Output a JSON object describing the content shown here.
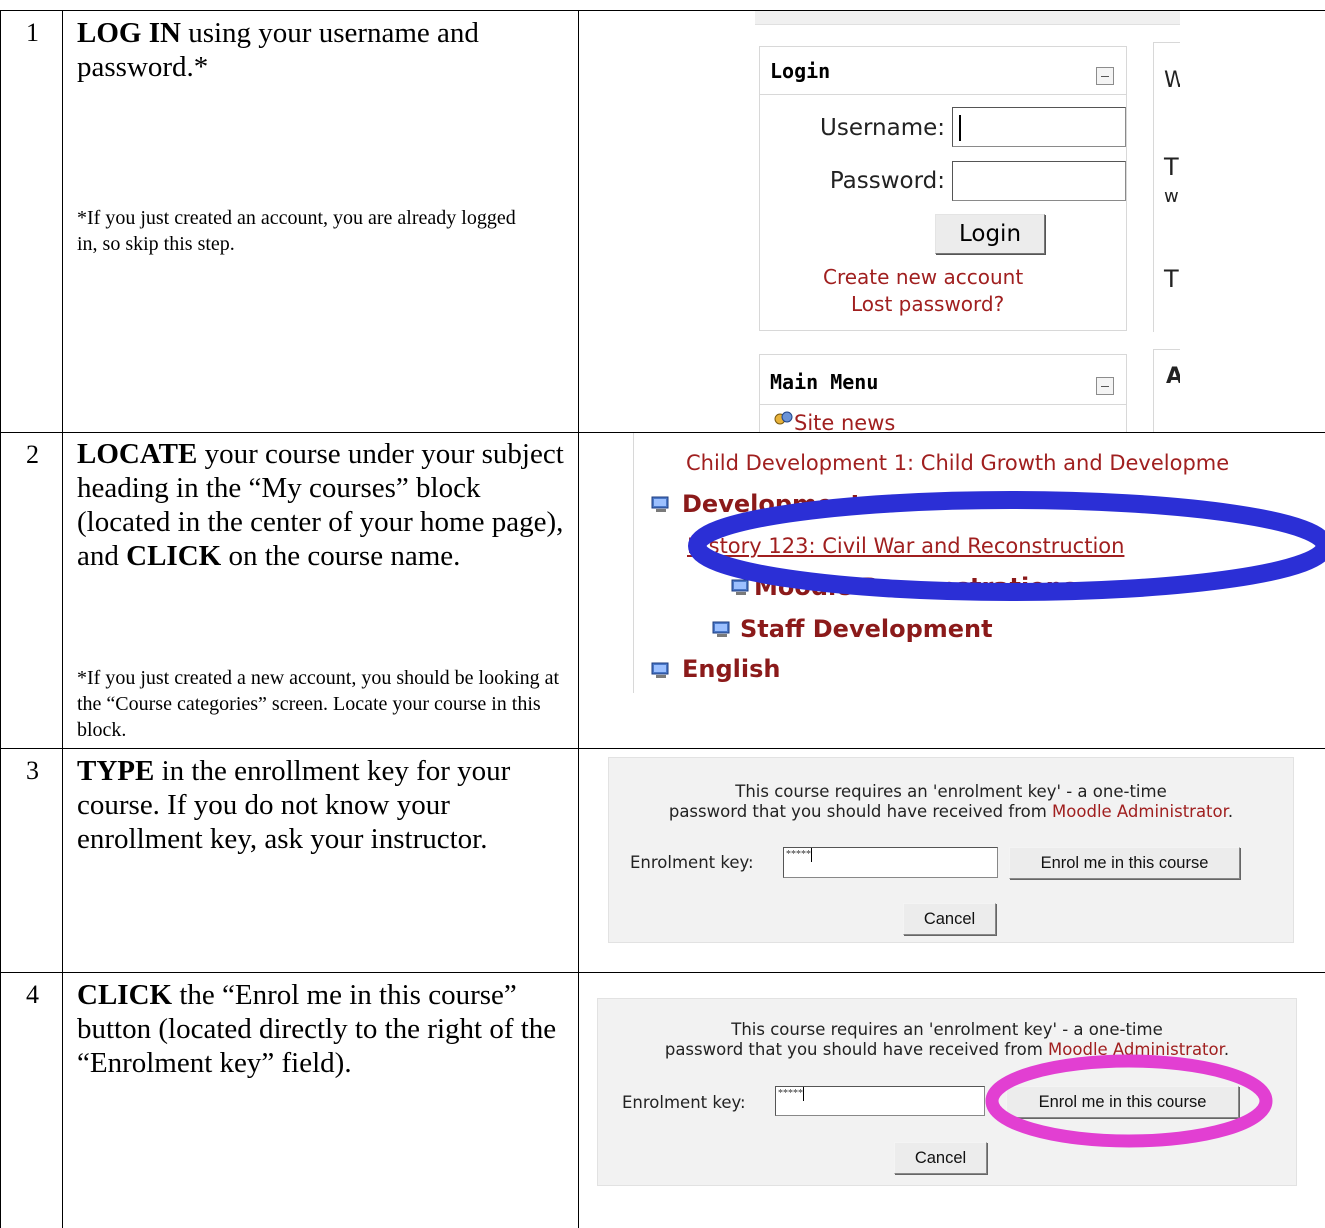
{
  "steps": [
    {
      "number": "1",
      "action": "LOG IN",
      "text": " using your username and password.*",
      "note": "*If you just created an account, you are already logged in, so skip this step."
    },
    {
      "number": "2",
      "action1": "LOCATE",
      "text1": " your course under your subject heading in the “My courses” block (located in the center of your home page), and ",
      "action2": "CLICK",
      "text2": " on the course name.",
      "note": "*If you just created a new account, you should be looking at the “Course categories” screen. Locate your course in this block."
    },
    {
      "number": "3",
      "action": "TYPE",
      "text": " in the enrollment key for your course. If you do not know your enrollment key, ask your instructor."
    },
    {
      "number": "4",
      "action": "CLICK",
      "text": " the “Enrol me in this course” button (located directly to the right of the “Enrolment key” field)."
    }
  ],
  "login_block": {
    "title": "Login",
    "username_label": "Username:",
    "password_label": "Password:",
    "login_button": "Login",
    "create_account": "Create new account",
    "lost_password": "Lost password?"
  },
  "side_glyphs": [
    "W",
    "T",
    "w",
    "T",
    "A"
  ],
  "main_menu": {
    "title": "Main Menu",
    "site_news": "Site news"
  },
  "categories": {
    "child_dev": "Child Development 1: Child Growth and Developme",
    "development": "Development",
    "history": "History 123: Civil War and Reconstruction",
    "moodle_demos": "Moodle Demonstrations",
    "staff_dev": "Staff Development",
    "english": "English",
    "highlight_color": "#2b2fd6"
  },
  "enrol": {
    "message_line1": "This course requires an 'enrolment key' - a one-time",
    "message_line2_prefix": "password that you should have received from ",
    "admin": "Moodle Administrator",
    "message_line2_suffix": ".",
    "key_label": "Enrolment key:",
    "key_value": "*****",
    "enrol_button": "Enrol me in this course",
    "cancel_button": "Cancel",
    "highlight_color": "#e23fd2"
  }
}
